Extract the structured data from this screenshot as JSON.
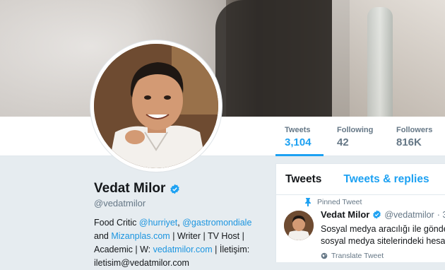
{
  "profile": {
    "name": "Vedat Milor",
    "handle": "@vedatmilor",
    "bio": {
      "line1_prefix": "Food Critic ",
      "mention1": "@hurriyet",
      "sep1": ", ",
      "mention2": "@gastromondiale",
      "line2_prefix": "and ",
      "link1": "Mizanplas.com",
      "line2_suffix": " | Writer | TV Host |",
      "line3_prefix": "Academic | W: ",
      "link2": "vedatmilor.com",
      "line3_suffix": " | İletişim:",
      "line4": "iletisim@vedatmilor.com"
    }
  },
  "stats": [
    {
      "label": "Tweets",
      "value": "3,104",
      "active": true
    },
    {
      "label": "Following",
      "value": "42",
      "active": false
    },
    {
      "label": "Followers",
      "value": "816K",
      "active": false
    }
  ],
  "timeline": {
    "tab_tweets": "Tweets",
    "tab_replies": "Tweets & replies",
    "pinned_label": "Pinned Tweet",
    "tweet": {
      "name": "Vedat Milor",
      "handle": "@vedatmilor",
      "sep": "· 3",
      "line1": "Sosyal medya aracılığı ile gönde",
      "line2": "sosyal medya sitelerindeki hesap"
    },
    "translate_label": "Translate Tweet"
  },
  "colors": {
    "accent": "#1da1f2",
    "muted": "#657786",
    "link": "#1b95e0",
    "page_bg": "#e6ecf0"
  },
  "icons": [
    "verified-badge-icon",
    "pin-icon",
    "globe-icon"
  ]
}
